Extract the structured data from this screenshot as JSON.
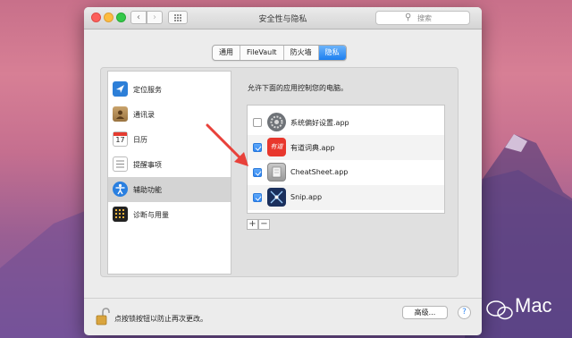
{
  "window": {
    "title": "安全性与隐私"
  },
  "search": {
    "placeholder": "搜索"
  },
  "tabs": [
    {
      "label": "通用",
      "active": false
    },
    {
      "label": "FileVault",
      "active": false
    },
    {
      "label": "防火墙",
      "active": false
    },
    {
      "label": "隐私",
      "active": true
    }
  ],
  "sidebar": {
    "items": [
      {
        "label": "定位服务",
        "icon": "location-icon",
        "selected": false
      },
      {
        "label": "通讯录",
        "icon": "contacts-icon",
        "selected": false
      },
      {
        "label": "日历",
        "icon": "calendar-icon",
        "selected": false,
        "icon_text": "17"
      },
      {
        "label": "提醒事项",
        "icon": "reminders-icon",
        "selected": false
      },
      {
        "label": "辅助功能",
        "icon": "accessibility-icon",
        "selected": true
      },
      {
        "label": "诊断与用量",
        "icon": "diagnostics-icon",
        "selected": false
      }
    ]
  },
  "main": {
    "prompt": "允许下面的应用控制您的电脑。",
    "apps": [
      {
        "name": "系统偏好设置.app",
        "checked": false,
        "icon": "system-preferences-icon"
      },
      {
        "name": "有道词典.app",
        "checked": true,
        "icon": "youdao-dict-icon",
        "icon_text": "有道"
      },
      {
        "name": "CheatSheet.app",
        "checked": true,
        "icon": "cheatsheet-icon"
      },
      {
        "name": "Snip.app",
        "checked": true,
        "icon": "snip-icon"
      }
    ],
    "add_label": "+",
    "remove_label": "−"
  },
  "footer": {
    "lock_text": "点按锁按钮以防止再次更改。",
    "advanced_label": "高级...",
    "help_label": "?"
  },
  "watermark": {
    "text": "Mac"
  },
  "colors": {
    "accent": "#2f86f2",
    "annotation_arrow": "#e8413a"
  }
}
